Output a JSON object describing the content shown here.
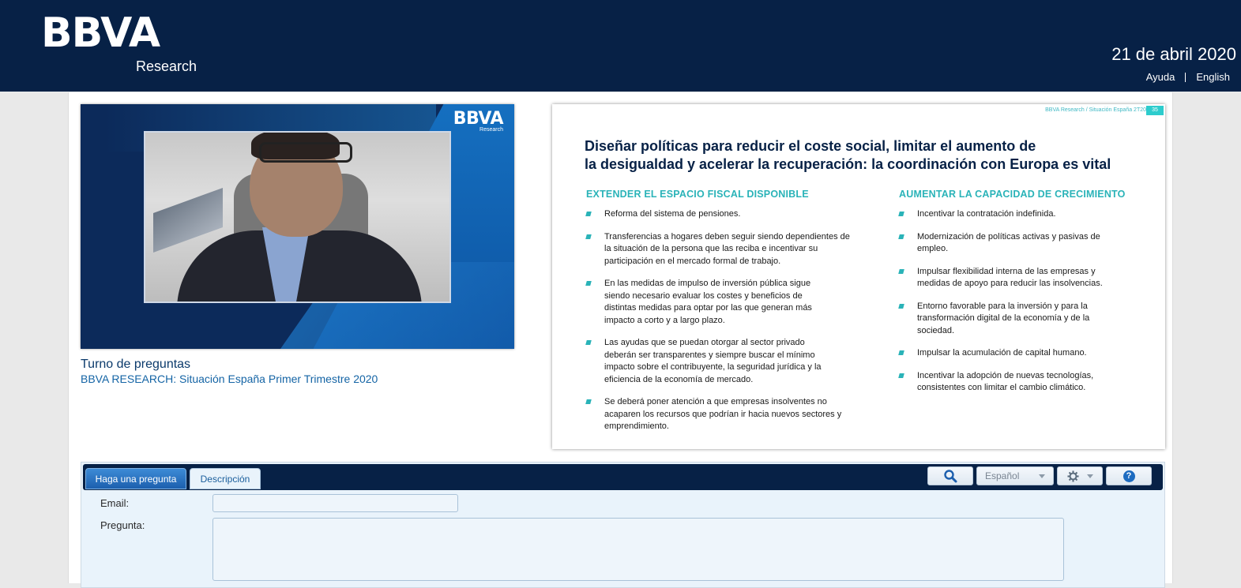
{
  "header": {
    "logo_text": "BBVA",
    "logo_sub": "Research",
    "date": "21 de abril 2020",
    "links": [
      {
        "label": "Ayuda"
      },
      {
        "label": "English"
      }
    ],
    "bg_color": "#072146"
  },
  "video": {
    "logo_text": "BBVA",
    "logo_sub": "Research",
    "caption_title": "Turno de preguntas",
    "caption_sub": "BBVA RESEARCH: Situación España Primer Trimestre 2020"
  },
  "slide": {
    "tag": "BBVA Research / Situación España 2T20",
    "page": "35",
    "title_line1": "Diseñar políticas para reducir el  coste social, limitar el aumento de",
    "title_line2": "la desigualdad y acelerar la recuperación: la coordinación con Europa es vital",
    "left": {
      "heading": "EXTENDER EL ESPACIO FISCAL DISPONIBLE",
      "items": [
        "Reforma del sistema de pensiones.",
        "Transferencias a hogares deben seguir siendo dependientes de la situación de la persona que las reciba e incentivar su participación en el mercado formal de trabajo.",
        "En las medidas de impulso de inversión pública sigue siendo necesario evaluar los costes y beneficios de distintas medidas para optar por las que generan más impacto a corto y a largo plazo.",
        "Las ayudas que se puedan otorgar al sector privado deberán ser transparentes y siempre buscar el mínimo impacto sobre el contribuyente, la seguridad jurídica y la eficiencia de la economía de mercado.",
        "Se deberá poner atención a que empresas insolventes no acaparen los recursos que podrían ir hacia nuevos sectores y emprendimiento."
      ]
    },
    "right": {
      "heading": "AUMENTAR LA CAPACIDAD DE CRECIMIENTO",
      "items": [
        "Incentivar la contratación indefinida.",
        "Modernización de políticas activas y pasivas de empleo.",
        "Impulsar flexibilidad interna de las empresas y medidas de apoyo para reducir las insolvencias.",
        "Entorno favorable para la inversión y para la transformación digital de la economía y de la sociedad.",
        "Impulsar la acumulación de capital humano.",
        "Incentivar la adopción de nuevas tecnologías, consistentes con limitar el cambio climático."
      ]
    },
    "accent_color": "#2ab3b8"
  },
  "question_panel": {
    "tabs": [
      {
        "label": "Haga una pregunta",
        "active": true
      },
      {
        "label": "Descripción",
        "active": false
      }
    ],
    "language_selected": "Español",
    "icons": [
      "search-icon",
      "gear-icon",
      "help-icon"
    ],
    "email_label": "Email:",
    "email_value": "",
    "question_label": "Pregunta:",
    "question_value": ""
  }
}
